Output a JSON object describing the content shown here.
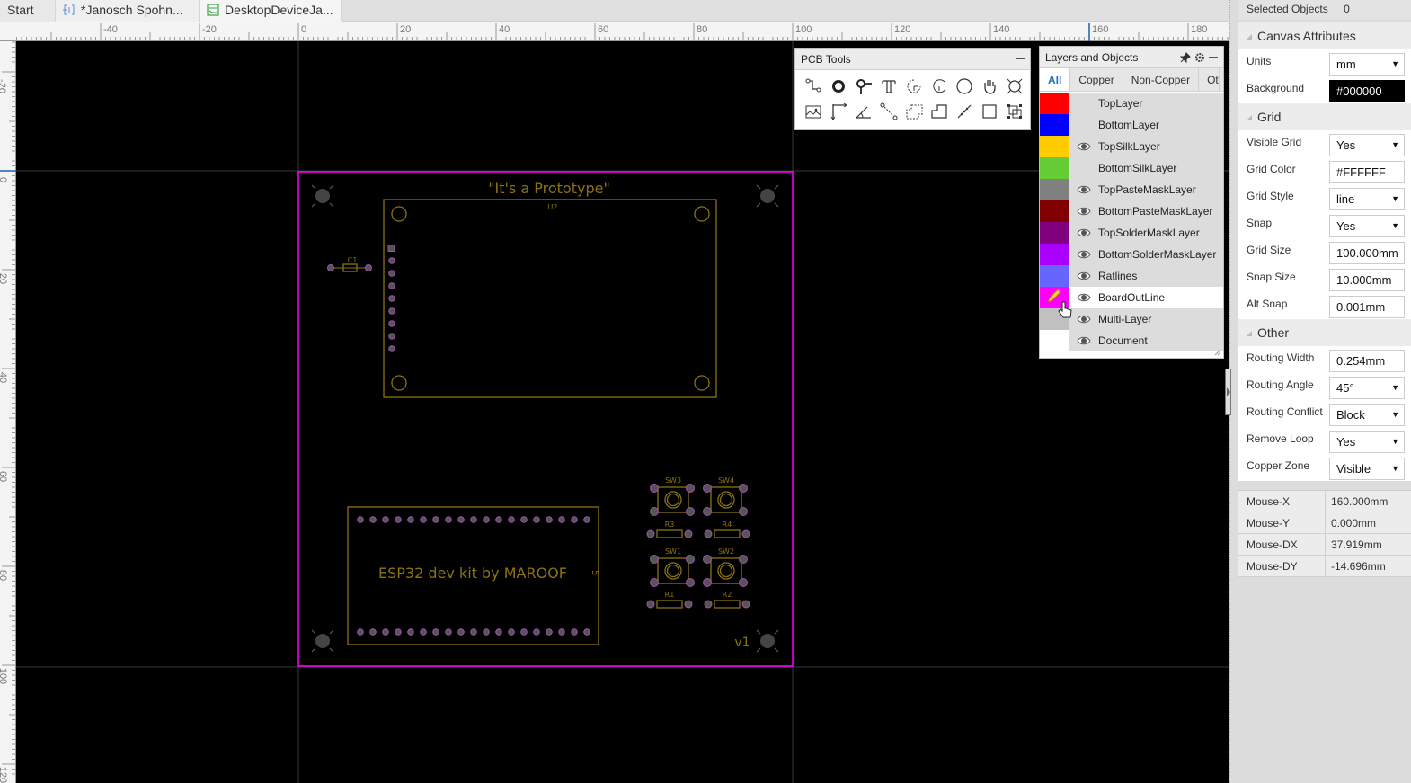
{
  "tabs": [
    {
      "label": "Start",
      "icon": "none"
    },
    {
      "label": "*Janosch Spohn...",
      "icon": "schematic-icon"
    },
    {
      "label": "DesktopDeviceJa...",
      "icon": "pcb-icon",
      "active": true
    }
  ],
  "ruler": {
    "horizontal_labels": [
      "-40",
      "-20",
      "0",
      "20",
      "40",
      "60",
      "80",
      "100",
      "120",
      "140",
      "160",
      "180"
    ],
    "vertical_labels": [
      "-20",
      "0",
      "20",
      "40",
      "60",
      "80",
      "100",
      "120"
    ],
    "cursor_marker_mm": 160
  },
  "pcb_tools": {
    "title": "PCB Tools",
    "tools": [
      {
        "name": "track-icon",
        "label": "Track"
      },
      {
        "name": "pad-icon",
        "label": "Pad"
      },
      {
        "name": "via-icon",
        "label": "Via"
      },
      {
        "name": "text-icon",
        "label": "Text"
      },
      {
        "name": "arc-center-icon",
        "label": "Arc"
      },
      {
        "name": "arc-icon",
        "label": "Arc 2"
      },
      {
        "name": "circle-icon",
        "label": "Circle"
      },
      {
        "name": "pan-hand-icon",
        "label": "Pan"
      },
      {
        "name": "hole-icon",
        "label": "Hole"
      },
      {
        "name": "image-icon",
        "label": "Image"
      },
      {
        "name": "dimension-icon",
        "label": "Dimension"
      },
      {
        "name": "protractor-icon",
        "label": "Protractor"
      },
      {
        "name": "connect-pad-icon",
        "label": "Connect Pad"
      },
      {
        "name": "solid-region-icon",
        "label": "Solid Region"
      },
      {
        "name": "copper-area-icon",
        "label": "Copper Area"
      },
      {
        "name": "measure-icon",
        "label": "Measure"
      },
      {
        "name": "rectangle-icon",
        "label": "Rectangle"
      },
      {
        "name": "group-icon",
        "label": "Group"
      }
    ]
  },
  "layers_panel": {
    "title": "Layers and Objects",
    "tabs": [
      "All",
      "Copper",
      "Non-Copper",
      "Ot"
    ],
    "active_tab": "All",
    "layers": [
      {
        "name": "TopLayer",
        "color": "#FF0000",
        "visible": false
      },
      {
        "name": "BottomLayer",
        "color": "#0000FF",
        "visible": false
      },
      {
        "name": "TopSilkLayer",
        "color": "#FFCC00",
        "visible": true
      },
      {
        "name": "BottomSilkLayer",
        "color": "#66CC33",
        "visible": false
      },
      {
        "name": "TopPasteMaskLayer",
        "color": "#808080",
        "visible": true
      },
      {
        "name": "BottomPasteMaskLayer",
        "color": "#800000",
        "visible": true
      },
      {
        "name": "TopSolderMaskLayer",
        "color": "#800080",
        "visible": true
      },
      {
        "name": "BottomSolderMaskLayer",
        "color": "#AA00FF",
        "visible": true
      },
      {
        "name": "Ratlines",
        "color": "#6666FF",
        "visible": true
      },
      {
        "name": "BoardOutLine",
        "color": "#FF00FF",
        "visible": true,
        "active": true
      },
      {
        "name": "Multi-Layer",
        "color": "#C0C0C0",
        "visible": true
      },
      {
        "name": "Document",
        "color": "#FFFFFF",
        "visible": true
      }
    ]
  },
  "board": {
    "title_text": "\"It's a Prototype\"",
    "module_label": "U2",
    "esp_label": "ESP32 dev kit by MAROOF",
    "esp_ref": "5",
    "version_label": "v1",
    "cap_label": "C1",
    "switches": [
      "SW3",
      "SW4",
      "SW1",
      "SW2"
    ],
    "resistors": [
      "R3",
      "R4",
      "R1",
      "R2"
    ],
    "outline_color": "#FF00FF",
    "silk_color": "#8B7312"
  },
  "properties": {
    "selected_objects_label": "Selected Objects",
    "selected_objects_value": "0",
    "sections": {
      "canvas": {
        "title": "Canvas Attributes",
        "rows": [
          {
            "label": "Units",
            "value": "mm",
            "type": "select"
          },
          {
            "label": "Background",
            "value": "#000000",
            "type": "color"
          }
        ]
      },
      "grid": {
        "title": "Grid",
        "rows": [
          {
            "label": "Visible Grid",
            "value": "Yes",
            "type": "select"
          },
          {
            "label": "Grid Color",
            "value": "#FFFFFF",
            "type": "input"
          },
          {
            "label": "Grid Style",
            "value": "line",
            "type": "select"
          },
          {
            "label": "Snap",
            "value": "Yes",
            "type": "select"
          },
          {
            "label": "Grid Size",
            "value": "100.000mm",
            "type": "input"
          },
          {
            "label": "Snap Size",
            "value": "10.000mm",
            "type": "input"
          },
          {
            "label": "Alt Snap",
            "value": "0.001mm",
            "type": "input"
          }
        ]
      },
      "other": {
        "title": "Other",
        "rows": [
          {
            "label": "Routing Width",
            "value": "0.254mm",
            "type": "input"
          },
          {
            "label": "Routing Angle",
            "value": "45°",
            "type": "select"
          },
          {
            "label": "Routing Conflict",
            "value": "Block",
            "type": "select"
          },
          {
            "label": "Remove Loop",
            "value": "Yes",
            "type": "select"
          },
          {
            "label": "Copper Zone",
            "value": "Visible",
            "type": "select"
          }
        ]
      }
    },
    "mouse": [
      {
        "label": "Mouse-X",
        "value": "160.000mm"
      },
      {
        "label": "Mouse-Y",
        "value": "0.000mm"
      },
      {
        "label": "Mouse-DX",
        "value": "37.919mm"
      },
      {
        "label": "Mouse-DY",
        "value": "-14.696mm"
      }
    ]
  }
}
